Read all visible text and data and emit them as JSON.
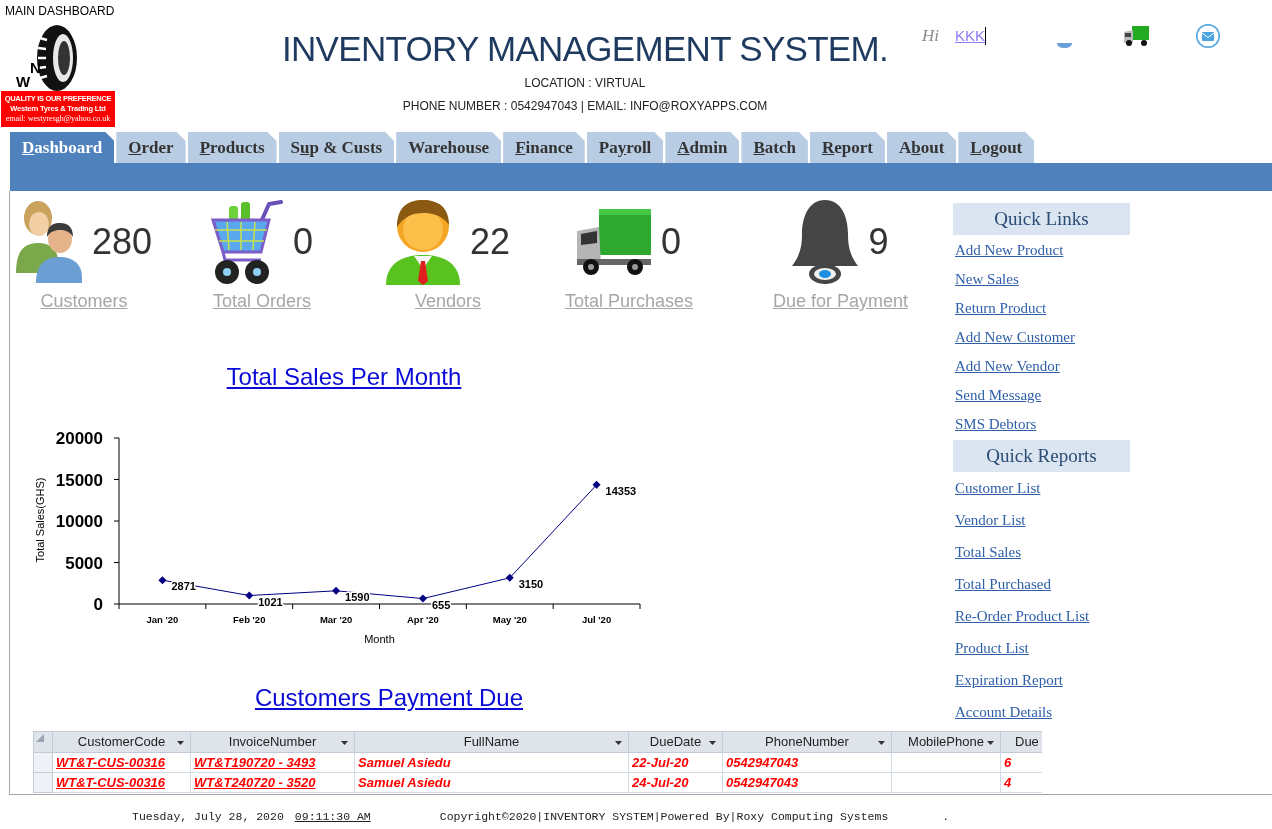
{
  "window": {
    "title": "MAIN DASHBOARD"
  },
  "logo": {
    "letters": [
      "W",
      "N"
    ],
    "lines": [
      "QUALITY IS OUR PREFERENCE",
      "Western Tyres & Trading Ltd",
      "email: westyresgh@yahoo.co.uk"
    ]
  },
  "header": {
    "title": "INVENTORY MANAGEMENT SYSTEM.",
    "location": "LOCATION : VIRTUAL",
    "contact": "PHONE NUMBER : 0542947043 | EMAIL: INFO@ROXYAPPS.COM"
  },
  "user": {
    "greeting": "Hi",
    "name": "KKK"
  },
  "tabs": [
    {
      "key": "D",
      "after": "ashboard",
      "selected": true
    },
    {
      "key": "O",
      "after": "rder",
      "selected": false
    },
    {
      "key": "P",
      "after": "roducts",
      "selected": false
    },
    {
      "before": "S",
      "key": "u",
      "after": "p & Custs",
      "selected": false
    },
    {
      "after": "Warehouse",
      "selected": false
    },
    {
      "key": "F",
      "after": "inance",
      "selected": false
    },
    {
      "before": "Pa",
      "key": "y",
      "after": "roll",
      "selected": false
    },
    {
      "key": "A",
      "after": "dmin",
      "selected": false
    },
    {
      "key": "B",
      "after": "atch",
      "selected": false
    },
    {
      "key": "R",
      "after": "eport",
      "selected": false
    },
    {
      "before": "A",
      "key": "b",
      "after": "out",
      "selected": false
    },
    {
      "key": "L",
      "after": "ogout",
      "selected": false
    }
  ],
  "stats": [
    {
      "kind": "customers",
      "value": "280",
      "label": "Customers"
    },
    {
      "kind": "orders",
      "value": "0",
      "label": "Total Orders"
    },
    {
      "kind": "vendors",
      "value": "22",
      "label": "Vendors"
    },
    {
      "kind": "purchases",
      "value": "0",
      "label": "Total Purchases"
    },
    {
      "kind": "payments",
      "value": "9",
      "label": "Due for Payment"
    }
  ],
  "sales_chart": {
    "chart_data": {
      "type": "line",
      "title": "Total Sales Per Month",
      "xlabel": "Month",
      "ylabel": "Total Sales(GHS)",
      "categories": [
        "Jan '20",
        "Feb '20",
        "Mar '20",
        "Apr '20",
        "May '20",
        "Jul '20"
      ],
      "values": [
        2871,
        1021,
        1590,
        655,
        3150,
        14353
      ],
      "ylim": [
        0,
        20000
      ],
      "yticks": [
        0,
        5000,
        10000,
        15000,
        20000
      ],
      "marker": "diamond",
      "data_labels": true
    }
  },
  "payment_due": {
    "title": "Customers Payment Due",
    "columns": [
      {
        "label": "CustomerCode",
        "kind": "link"
      },
      {
        "label": "InvoiceNumber",
        "kind": "link"
      },
      {
        "label": "FullName",
        "kind": "text"
      },
      {
        "label": "DueDate",
        "kind": "text"
      },
      {
        "label": "PhoneNumber",
        "kind": "text"
      },
      {
        "label": "MobilePhone",
        "kind": "text"
      },
      {
        "label": "Due",
        "kind": "text"
      }
    ],
    "rows": [
      [
        "WT&T-CUS-00316",
        "WT&T190720 - 3493",
        "Samuel Asiedu",
        "22-Jul-20",
        "0542947043",
        null,
        "6"
      ],
      [
        "WT&T-CUS-00316",
        "WT&T240720 - 3520",
        "Samuel Asiedu",
        "24-Jul-20",
        "0542947043",
        null,
        "4"
      ]
    ]
  },
  "quick_links": {
    "title": "Quick Links",
    "items": [
      "Add New Product",
      "New Sales",
      "Return Product",
      "Add New Customer",
      "Add New Vendor",
      "Send Message",
      "SMS Debtors"
    ]
  },
  "quick_reports": {
    "title": "Quick Reports",
    "items": [
      "Customer List",
      "Vendor List",
      "Total Sales",
      "Total Purchased",
      "Re-Order Product List",
      "Product List",
      "Expiration Report",
      "Account Details"
    ]
  },
  "status_bar": {
    "date": "Tuesday, July 28, 2020",
    "time": "09:11:30 AM",
    "copyright": "Copyright©2020|INVENTORY SYSTEM|Powered By|Roxy Computing Systems",
    "trailing_text": "."
  }
}
